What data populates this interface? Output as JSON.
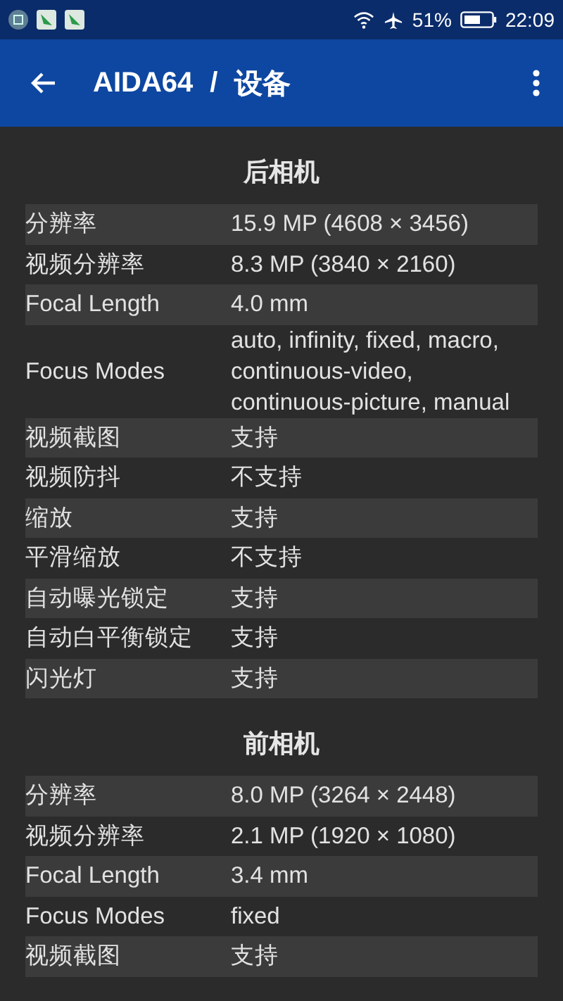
{
  "status_bar": {
    "battery_percent": "51%",
    "time": "22:09"
  },
  "app_bar": {
    "title": "AIDA64",
    "separator": "/",
    "subtitle": "设备"
  },
  "sections": [
    {
      "title": "后相机",
      "rows": [
        {
          "label": "分辨率",
          "value": "15.9 MP (4608 × 3456)"
        },
        {
          "label": "视频分辨率",
          "value": "8.3 MP (3840 × 2160)"
        },
        {
          "label": "Focal Length",
          "value": "4.0 mm"
        },
        {
          "label": "Focus Modes",
          "value": "auto, infinity, fixed, macro, continuous-video, continuous-picture, manual"
        },
        {
          "label": "视频截图",
          "value": "支持"
        },
        {
          "label": "视频防抖",
          "value": "不支持"
        },
        {
          "label": "缩放",
          "value": "支持"
        },
        {
          "label": "平滑缩放",
          "value": "不支持"
        },
        {
          "label": "自动曝光锁定",
          "value": "支持"
        },
        {
          "label": "自动白平衡锁定",
          "value": "支持"
        },
        {
          "label": "闪光灯",
          "value": "支持"
        }
      ]
    },
    {
      "title": "前相机",
      "rows": [
        {
          "label": "分辨率",
          "value": "8.0 MP (3264 × 2448)"
        },
        {
          "label": "视频分辨率",
          "value": "2.1 MP (1920 × 1080)"
        },
        {
          "label": "Focal Length",
          "value": "3.4 mm"
        },
        {
          "label": "Focus Modes",
          "value": "fixed"
        },
        {
          "label": "视频截图",
          "value": "支持"
        }
      ]
    }
  ]
}
